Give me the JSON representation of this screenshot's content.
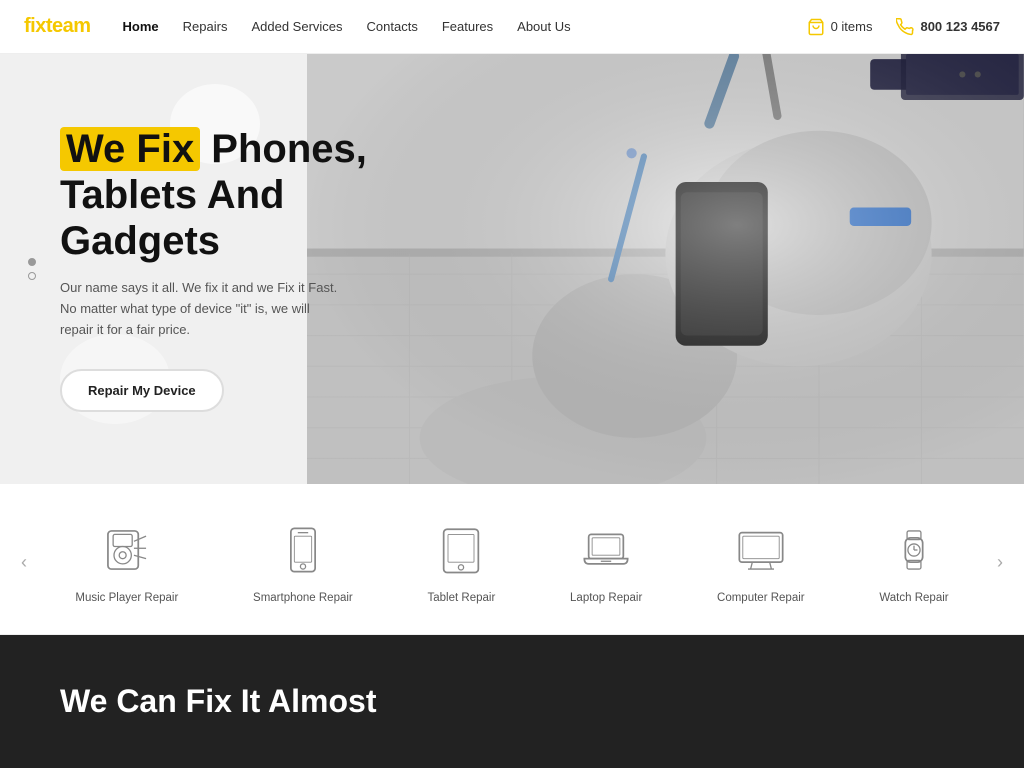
{
  "brand": {
    "fix": "fix",
    "team": "team"
  },
  "navbar": {
    "links": [
      {
        "label": "Home",
        "active": true
      },
      {
        "label": "Repairs",
        "active": false
      },
      {
        "label": "Added Services",
        "active": false
      },
      {
        "label": "Contacts",
        "active": false
      },
      {
        "label": "Features",
        "active": false
      },
      {
        "label": "About Us",
        "active": false
      }
    ],
    "cart_label": "0 items",
    "phone": "800 123 4567"
  },
  "hero": {
    "title_part1": "We Fix",
    "title_part2": " Phones,",
    "title_line2": "Tablets And",
    "title_line3": "Gadgets",
    "description": "Our name says it all. We fix it and we Fix it Fast. No matter what type of device \"it\" is, we will repair it for a fair price.",
    "cta_label": "Repair My Device"
  },
  "services": {
    "items": [
      {
        "label": "Music Player Repair",
        "icon": "music-player"
      },
      {
        "label": "Smartphone Repair",
        "icon": "smartphone"
      },
      {
        "label": "Tablet Repair",
        "icon": "tablet"
      },
      {
        "label": "Laptop Repair",
        "icon": "laptop"
      },
      {
        "label": "Computer Repair",
        "icon": "computer"
      },
      {
        "label": "Watch Repair",
        "icon": "watch"
      }
    ],
    "prev_arrow": "‹",
    "next_arrow": "›"
  },
  "dark_section": {
    "title": "We Can Fix It Almost"
  },
  "colors": {
    "accent": "#f5c800",
    "dark": "#222",
    "light_text": "#555"
  }
}
